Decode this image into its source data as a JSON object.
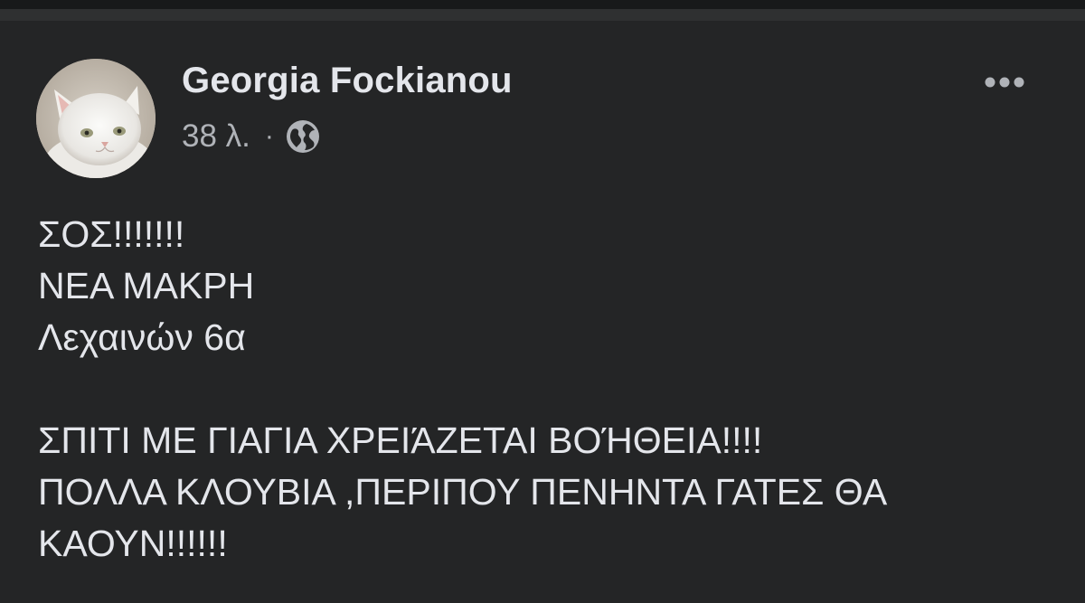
{
  "post": {
    "author": "Georgia Fockianou",
    "timestamp": "38 λ.",
    "separator": "·",
    "privacy_icon": "globe-icon",
    "menu_icon": "more-horizontal-icon",
    "avatar_icon": "white-cat-avatar",
    "text_lines": [
      "ΣΟΣ!!!!!!!",
      "ΝΕΑ ΜΑΚΡΗ",
      "Λεχαινών 6α",
      "",
      "ΣΠΙΤΙ ΜΕ ΓΙΑΓΙΑ ΧΡΕΙΆΖΕΤΑΙ ΒΟΉΘΕΙΑ!!!!",
      "ΠΟΛΛΑ ΚΛΟΥΒΙΑ ,ΠΕΡΙΠΟΥ ΠΕΝΗΝΤΑ ΓΑΤΕΣ ΘΑ",
      "ΚΑΟΥΝ!!!!!!"
    ]
  },
  "colors": {
    "background": "#242526",
    "top_bar": "#18191a",
    "primary_text": "#e4e6eb",
    "secondary_text": "#b0b3b8"
  }
}
